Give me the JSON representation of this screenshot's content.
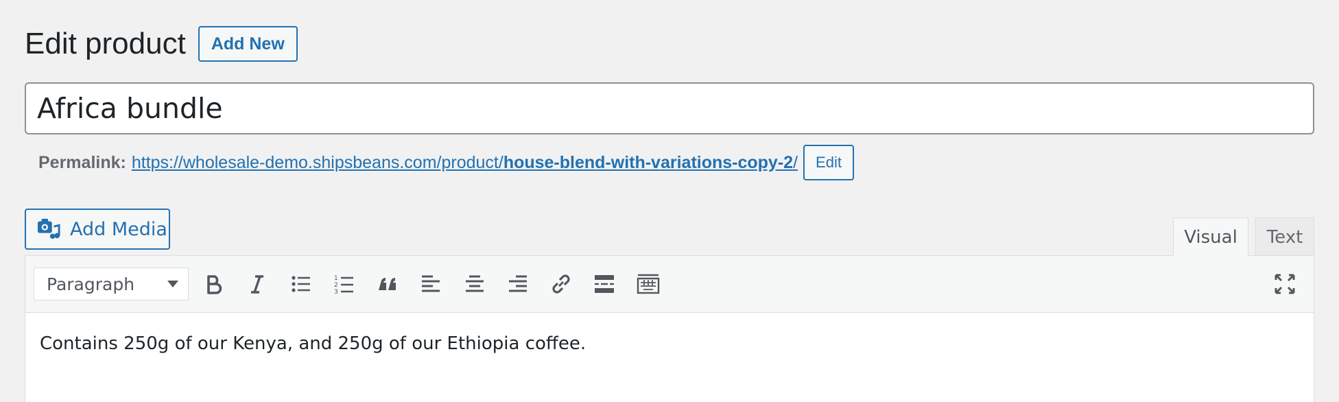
{
  "header": {
    "title": "Edit product",
    "add_new_label": "Add New"
  },
  "post": {
    "title_value": "Africa bundle"
  },
  "permalink": {
    "label": "Permalink:",
    "base_url": "https://wholesale-demo.shipsbeans.com/product/",
    "slug": "house-blend-with-variations-copy-2",
    "trailing": "/",
    "edit_label": "Edit"
  },
  "media": {
    "add_media_label": "Add Media"
  },
  "editor": {
    "tabs": [
      {
        "label": "Visual",
        "active": true
      },
      {
        "label": "Text",
        "active": false
      }
    ],
    "format_select_value": "Paragraph",
    "toolbar_icons": [
      "bold-icon",
      "italic-icon",
      "bulleted-list-icon",
      "numbered-list-icon",
      "blockquote-icon",
      "align-left-icon",
      "align-center-icon",
      "align-right-icon",
      "link-icon",
      "read-more-icon",
      "toolbar-toggle-icon",
      "fullscreen-icon"
    ],
    "content": "Contains 250g of our Kenya, and 250g of our Ethiopia coffee."
  },
  "colors": {
    "accent": "#2271b1",
    "background": "#f1f1f1",
    "text": "#1d2327",
    "icon": "#50575e"
  }
}
